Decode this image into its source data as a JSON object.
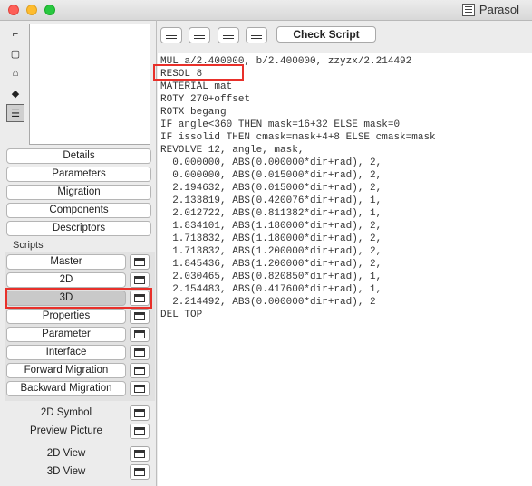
{
  "window": {
    "title": "Parasol"
  },
  "left_tools": [
    {
      "icon": "select-tool-icon",
      "glyph": "⌐"
    },
    {
      "icon": "rectangle-tool-icon",
      "glyph": "▢"
    },
    {
      "icon": "floor-plan-icon",
      "glyph": "⌂"
    },
    {
      "icon": "3d-cube-icon",
      "glyph": "◆"
    },
    {
      "icon": "list-view-icon",
      "glyph": "☰"
    }
  ],
  "top_buttons": [
    "Details",
    "Parameters",
    "Migration",
    "Components",
    "Descriptors"
  ],
  "scripts_label": "Scripts",
  "scripts": [
    "Master",
    "2D",
    "3D",
    "Properties",
    "Parameter",
    "Interface",
    "Forward Migration",
    "Backward Migration"
  ],
  "selected_script": "3D",
  "extra_items": [
    "2D Symbol",
    "Preview Picture"
  ],
  "view_items": [
    "2D View",
    "3D View"
  ],
  "toolbar": {
    "check_script_label": "Check Script"
  },
  "code_lines": [
    "MUL a/2.400000, b/2.400000, zzyzx/2.214492",
    "RESOL 8",
    "MATERIAL mat",
    "ROTY 270+offset",
    "ROTX begang",
    "IF angle<360 THEN mask=16+32 ELSE mask=0",
    "IF issolid THEN cmask=mask+4+8 ELSE cmask=mask",
    "REVOLVE 12, angle, mask,",
    "  0.000000, ABS(0.000000*dir+rad), 2,",
    "  0.000000, ABS(0.015000*dir+rad), 2,",
    "  2.194632, ABS(0.015000*dir+rad), 2,",
    "  2.133819, ABS(0.420076*dir+rad), 1,",
    "  2.012722, ABS(0.811382*dir+rad), 1,",
    "  1.834101, ABS(1.180000*dir+rad), 2,",
    "  1.713832, ABS(1.180000*dir+rad), 2,",
    "  1.713832, ABS(1.200000*dir+rad), 2,",
    "  1.845436, ABS(1.200000*dir+rad), 2,",
    "  2.030465, ABS(0.820850*dir+rad), 1,",
    "  2.154483, ABS(0.417600*dir+rad), 1,",
    "  2.214492, ABS(0.000000*dir+rad), 2",
    "DEL TOP"
  ]
}
